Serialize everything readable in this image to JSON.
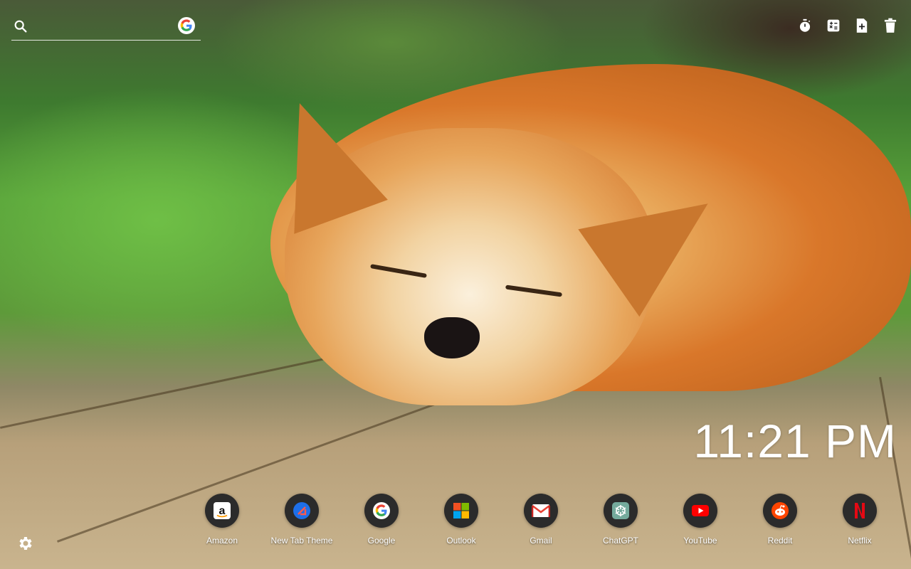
{
  "search": {
    "placeholder": ""
  },
  "toolbar": {
    "icons": [
      "timer-icon",
      "calculator-icon",
      "new-note-icon",
      "trash-icon"
    ]
  },
  "clock": {
    "time": "11:21 PM"
  },
  "dock": {
    "apps": [
      {
        "label": "Amazon",
        "icon": "amazon-icon"
      },
      {
        "label": "New Tab Theme",
        "icon": "new-tab-theme-icon"
      },
      {
        "label": "Google",
        "icon": "google-icon"
      },
      {
        "label": "Outlook",
        "icon": "microsoft-icon"
      },
      {
        "label": "Gmail",
        "icon": "gmail-icon"
      },
      {
        "label": "ChatGPT",
        "icon": "chatgpt-icon"
      },
      {
        "label": "YouTube",
        "icon": "youtube-icon"
      },
      {
        "label": "Reddit",
        "icon": "reddit-icon"
      },
      {
        "label": "Netflix",
        "icon": "netflix-icon"
      }
    ]
  },
  "colors": {
    "dock_circle": "#2b2b2b",
    "text": "#ffffff"
  }
}
